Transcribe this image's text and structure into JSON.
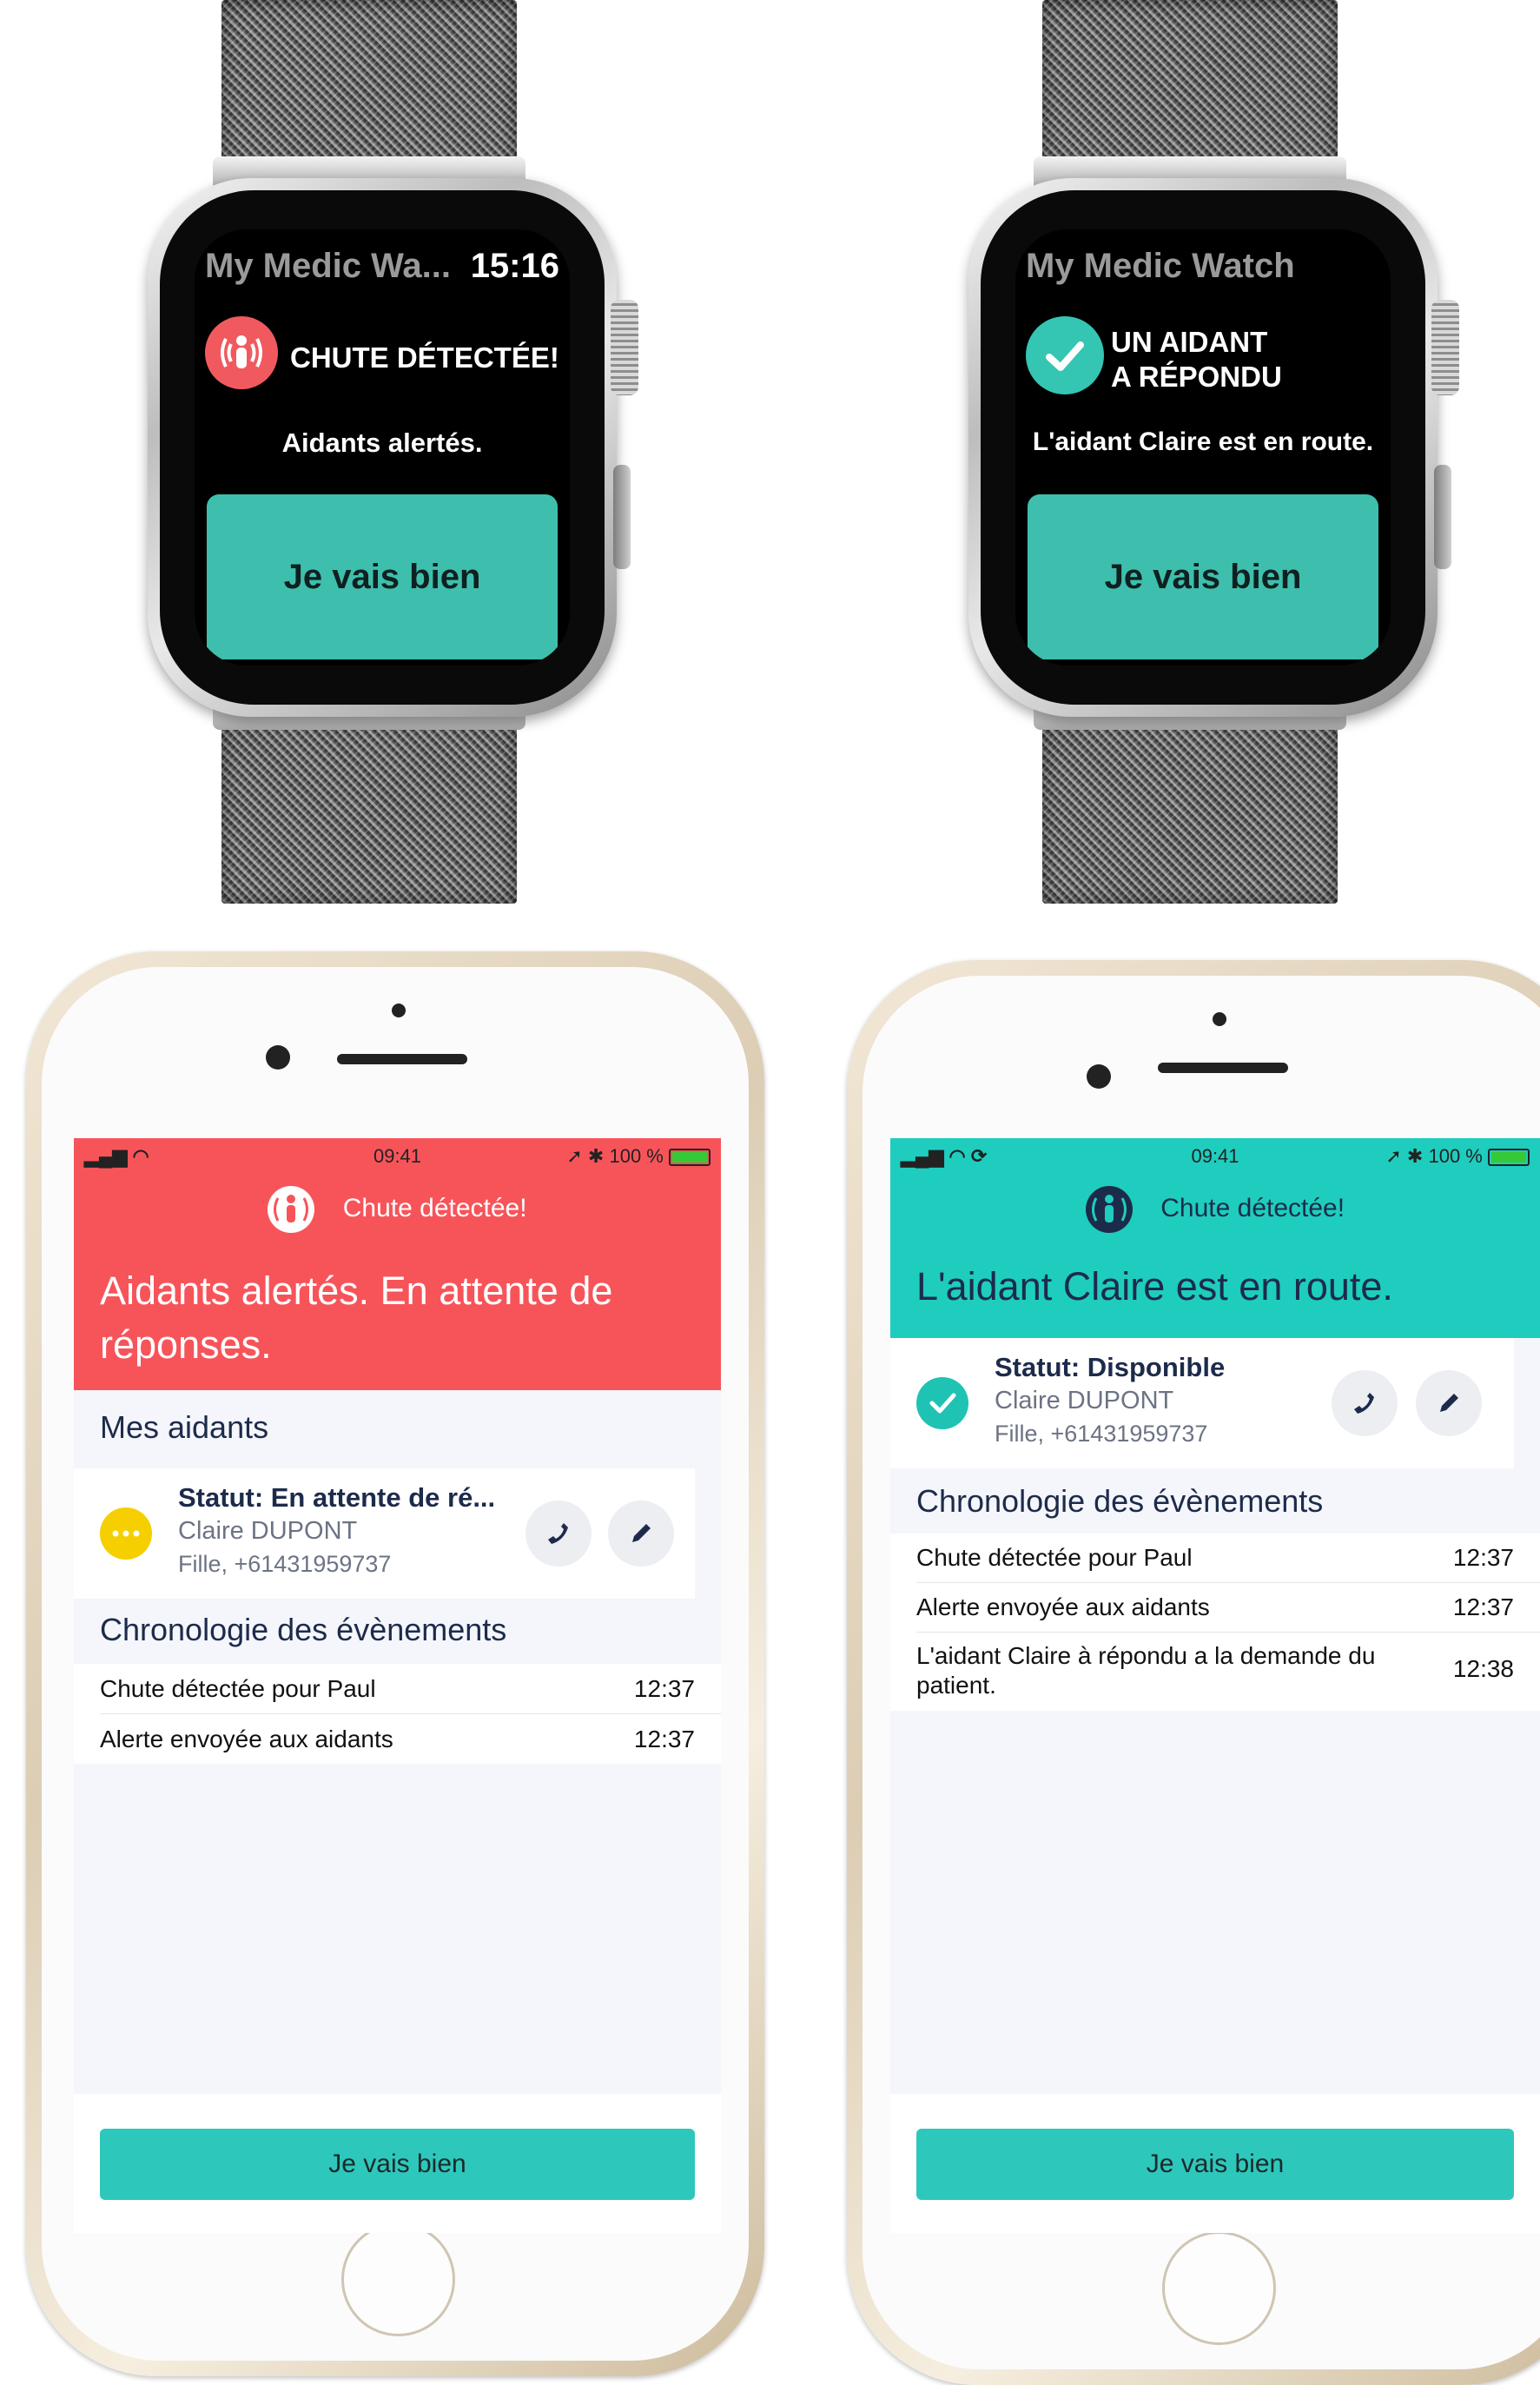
{
  "watch1": {
    "app_title": "My Medic Wa...",
    "time": "15:16",
    "headline": "CHUTE DÉTECTÉE!",
    "message": "Aidants alertés.",
    "button": "Je vais bien",
    "alert_icon": "fall-alert-icon",
    "alert_color": "#f05a5f",
    "button_color": "#3ebfad"
  },
  "watch2": {
    "app_title": "My Medic Watch",
    "headline_line1": "UN AIDANT",
    "headline_line2": "A RÉPONDU",
    "message": "L'aidant Claire est en route.",
    "button": "Je vais bien",
    "check_icon": "check-icon",
    "check_color": "#34c5b3"
  },
  "phone1": {
    "status_time": "09:41",
    "status_battery": "100 %",
    "header_color": "#f7545a",
    "header_title": "Chute détectée!",
    "header_message": "Aidants alertés. En attente de réponses.",
    "caregivers_title": "Mes aidants",
    "caregiver": {
      "status": "Statut: En attente de ré...",
      "name": "Claire DUPONT",
      "relation": "Fille, +61431959737",
      "badge_color": "#f5cf00"
    },
    "timeline_title": "Chronologie des évènements",
    "timeline": [
      {
        "event": "Chute détectée pour Paul",
        "time": "12:37"
      },
      {
        "event": "Alerte envoyée aux aidants",
        "time": "12:37"
      }
    ],
    "button": "Je vais bien"
  },
  "phone2": {
    "status_time": "09:41",
    "status_battery": "100 %",
    "header_color": "#1ecdbe",
    "header_title": "Chute détectée!",
    "header_message": "L'aidant Claire est en route.",
    "caregiver": {
      "status": "Statut: Disponible",
      "name": "Claire DUPONT",
      "relation": "Fille, +61431959737",
      "badge_color": "#1fc3b4"
    },
    "timeline_title": "Chronologie des évènements",
    "timeline": [
      {
        "event": "Chute détectée pour Paul",
        "time": "12:37"
      },
      {
        "event": "Alerte envoyée aux aidants",
        "time": "12:37"
      },
      {
        "event": "L'aidant Claire à répondu a la demande du patient.",
        "time": "12:38"
      }
    ],
    "button": "Je vais bien"
  }
}
